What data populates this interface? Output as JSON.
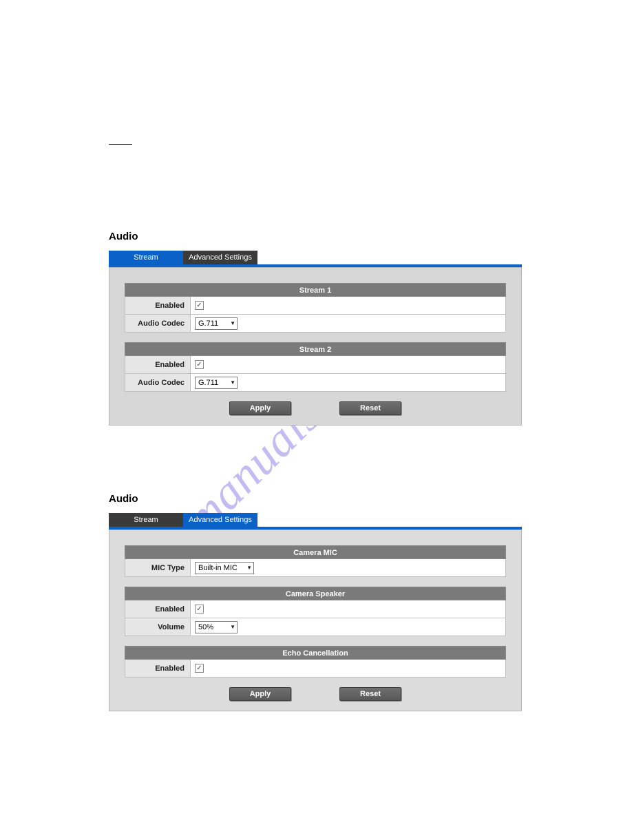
{
  "watermark": "manualshive.com",
  "section1": {
    "title": "Audio",
    "tabs": {
      "stream": "Stream",
      "advanced": "Advanced Settings"
    },
    "stream1": {
      "header": "Stream 1",
      "enabled_label": "Enabled",
      "enabled_checked": "✓",
      "codec_label": "Audio Codec",
      "codec_value": "G.711"
    },
    "stream2": {
      "header": "Stream 2",
      "enabled_label": "Enabled",
      "enabled_checked": "✓",
      "codec_label": "Audio Codec",
      "codec_value": "G.711"
    },
    "buttons": {
      "apply": "Apply",
      "reset": "Reset"
    }
  },
  "section2": {
    "title": "Audio",
    "tabs": {
      "stream": "Stream",
      "advanced": "Advanced Settings"
    },
    "mic": {
      "header": "Camera MIC",
      "type_label": "MIC Type",
      "type_value": "Built-in MIC"
    },
    "speaker": {
      "header": "Camera Speaker",
      "enabled_label": "Enabled",
      "enabled_checked": "✓",
      "volume_label": "Volume",
      "volume_value": "50%"
    },
    "echo": {
      "header": "Echo Cancellation",
      "enabled_label": "Enabled",
      "enabled_checked": "✓"
    },
    "buttons": {
      "apply": "Apply",
      "reset": "Reset"
    }
  }
}
